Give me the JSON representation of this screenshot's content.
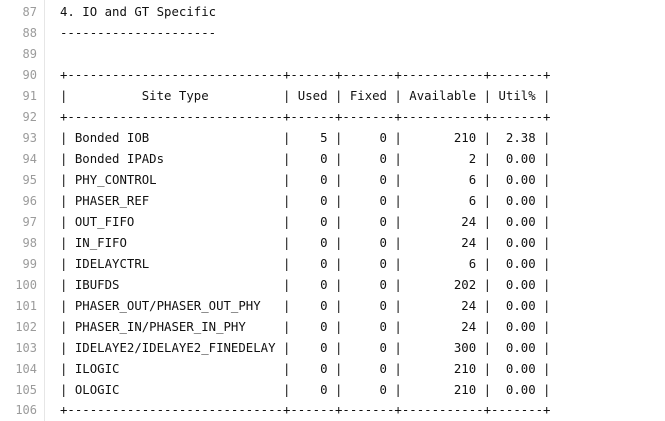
{
  "editor": {
    "lines": [
      {
        "num": "87",
        "text": "4. IO and GT Specific"
      },
      {
        "num": "88",
        "text": "---------------------"
      },
      {
        "num": "89",
        "text": ""
      },
      {
        "num": "90",
        "text": "+-----------------------------+------+-------+-----------+-------+"
      },
      {
        "num": "91",
        "text": "|          Site Type          | Used | Fixed | Available | Util% |"
      },
      {
        "num": "92",
        "text": "+-----------------------------+------+-------+-----------+-------+"
      },
      {
        "num": "93",
        "text": "| Bonded IOB                  |    5 |     0 |       210 |  2.38 |"
      },
      {
        "num": "94",
        "text": "| Bonded IPADs                |    0 |     0 |         2 |  0.00 |"
      },
      {
        "num": "95",
        "text": "| PHY_CONTROL                 |    0 |     0 |         6 |  0.00 |"
      },
      {
        "num": "96",
        "text": "| PHASER_REF                  |    0 |     0 |         6 |  0.00 |"
      },
      {
        "num": "97",
        "text": "| OUT_FIFO                    |    0 |     0 |        24 |  0.00 |"
      },
      {
        "num": "98",
        "text": "| IN_FIFO                     |    0 |     0 |        24 |  0.00 |"
      },
      {
        "num": "99",
        "text": "| IDELAYCTRL                  |    0 |     0 |         6 |  0.00 |"
      },
      {
        "num": "100",
        "text": "| IBUFDS                      |    0 |     0 |       202 |  0.00 |"
      },
      {
        "num": "101",
        "text": "| PHASER_OUT/PHASER_OUT_PHY   |    0 |     0 |        24 |  0.00 |"
      },
      {
        "num": "102",
        "text": "| PHASER_IN/PHASER_IN_PHY     |    0 |     0 |        24 |  0.00 |"
      },
      {
        "num": "103",
        "text": "| IDELAYE2/IDELAYE2_FINEDELAY |    0 |     0 |       300 |  0.00 |"
      },
      {
        "num": "104",
        "text": "| ILOGIC                      |    0 |     0 |       210 |  0.00 |"
      },
      {
        "num": "105",
        "text": "| OLOGIC                      |    0 |     0 |       210 |  0.00 |"
      },
      {
        "num": "106",
        "text": "+-----------------------------+------+-------+-----------+-------+"
      }
    ]
  }
}
